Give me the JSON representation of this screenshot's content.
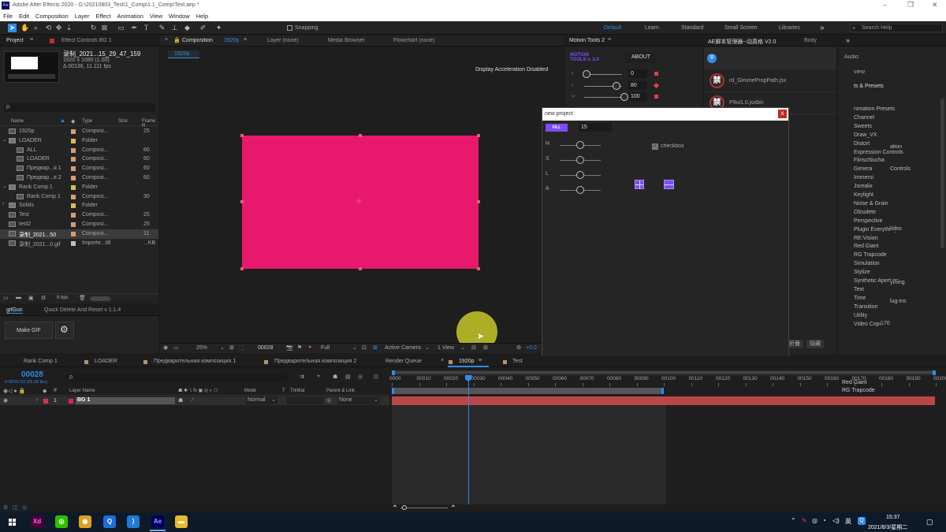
{
  "window": {
    "title": "Adobe After Effects 2020 - G:\\20210803_Test\\1_Comp\\1.1_Comp\\Text.aep *",
    "controls": {
      "minimize": "–",
      "maximize": "❐",
      "close": "✕"
    }
  },
  "menu": [
    "File",
    "Edit",
    "Composition",
    "Layer",
    "Effect",
    "Animation",
    "View",
    "Window",
    "Help"
  ],
  "toolbar": {
    "snapping_label": "Snapping",
    "workspaces": [
      "Default",
      "Learn",
      "Standard",
      "Small Screen",
      "Libraries"
    ],
    "more": "»",
    "search_placeholder": "Search Help"
  },
  "project": {
    "tab_label": "Project",
    "effect_controls_label": "Effect Controls BG 1",
    "footage_name": "录制_2021...15_29_47_159",
    "footage_res": "1920 x 1080 (1.00)",
    "footage_dur": "Δ 00136, 11.111 fps",
    "search_placeholder": "ρ.",
    "columns": [
      "Name",
      "Type",
      "Size",
      "Frame R"
    ],
    "rows": [
      {
        "name": "1920p",
        "type": "Composi...",
        "size": "25",
        "color": "#d0a070",
        "indent": 1,
        "expand": ""
      },
      {
        "name": "LOADER",
        "type": "Folder",
        "size": "",
        "color": "#d4c050",
        "indent": 0,
        "expand": "⌄"
      },
      {
        "name": "ALL",
        "type": "Composi...",
        "size": "60",
        "color": "#d0a070",
        "indent": 2,
        "expand": ""
      },
      {
        "name": "LOADER",
        "type": "Composi...",
        "size": "60",
        "color": "#d0a070",
        "indent": 2,
        "expand": ""
      },
      {
        "name": "Предвар...я 1",
        "type": "Composi...",
        "size": "60",
        "color": "#d0a070",
        "indent": 2,
        "expand": ""
      },
      {
        "name": "Предвар...я 2",
        "type": "Composi...",
        "size": "60",
        "color": "#d0a070",
        "indent": 2,
        "expand": ""
      },
      {
        "name": "Rank Comp 1",
        "type": "Folder",
        "size": "",
        "color": "#d4c050",
        "indent": 0,
        "expand": "⌄"
      },
      {
        "name": "Rank Comp 1",
        "type": "Composi...",
        "size": "30",
        "color": "#d0a070",
        "indent": 2,
        "expand": ""
      },
      {
        "name": "Solids",
        "type": "Folder",
        "size": "",
        "color": "#d4c050",
        "indent": 0,
        "expand": "›"
      },
      {
        "name": "Test",
        "type": "Composi...",
        "size": "25",
        "color": "#d0a070",
        "indent": 1,
        "expand": ""
      },
      {
        "name": "test2",
        "type": "Composi...",
        "size": "25",
        "color": "#d0a070",
        "indent": 1,
        "expand": ""
      },
      {
        "name": "录制_2021...50",
        "type": "Composi...",
        "size": "11",
        "color": "#d0a070",
        "indent": 1,
        "expand": ""
      },
      {
        "name": "录制_2021...0.gif",
        "type": "Importe...till",
        "size": "...KB",
        "color": "#c0c0c0",
        "indent": 1,
        "expand": ""
      }
    ],
    "bpc": "8 bpc"
  },
  "gifgun": {
    "tab": "gifGun",
    "tab2": "Quick Delete And Reset v 1.1.4",
    "make_gif": "Make GIF"
  },
  "comp_tabs": {
    "composition": "Composition",
    "comp_name": "1920p",
    "layer": "Layer (none)",
    "media_browser": "Media Browser",
    "flowchart": "Flowchart (none)",
    "breadcrumb": "1920p"
  },
  "viewer": {
    "display_accel": "Display Acceleration Disabled",
    "zoom": "25%",
    "timecode": "00028",
    "resolution": "Full",
    "camera": "Active Camera",
    "view": "1 View",
    "exposure": "+0.0",
    "comp_color": "#e8186d"
  },
  "motion_tools": {
    "tab": "Motion Tools 2",
    "logo_line1": "MOTION",
    "logo_line2": "TOOLS v. 2.0",
    "about": "ABOUT",
    "sliders": [
      {
        "icon": "‹",
        "value": "0",
        "level": 0.0
      },
      {
        "icon": "›",
        "value": "80",
        "level": 0.8
      },
      {
        "icon": "›‹",
        "value": "100",
        "level": 1.0
      }
    ]
  },
  "script_manager": {
    "tab": "AE脚本管理器--动真格 V2.0",
    "body_tab": "Body",
    "badge": "禁",
    "items": [
      "rd_GimmePropPath.jsx",
      "P9ui1.0.jsxbin"
    ],
    "cn_buttons": [
      "折叠",
      "隐藏"
    ]
  },
  "effects_panel": {
    "audio": "Audio",
    "preview": "view",
    "title": "ts & Presets",
    "items": [
      "nimation Presets",
      "Channel",
      "Sweets",
      "Draw_VX",
      "Distort",
      "Expression Controls",
      "Flinschlucha",
      "Genera",
      "Immersi",
      "Jsrealix",
      "Keylight",
      "Noise & Grain",
      "Obsolete",
      "Perspective",
      "Plugin Everything",
      "RE:Vision",
      "Red Giant",
      "RG Trapcode",
      "Simulation",
      "Stylize",
      "Synthetic Aperture",
      "Text",
      "Time",
      "Transition",
      "Utility",
      "Video Copilot"
    ],
    "bottom": [
      "Red Giant",
      "RG Trapcode"
    ],
    "overlap_fragments": [
      "ation",
      "Controls",
      "lideo",
      "ything",
      "lug-ins",
      "170"
    ]
  },
  "dialog": {
    "title": "new project",
    "close": "x",
    "fill_btn": "FILL",
    "value": "15",
    "sliders": [
      {
        "label": "H",
        "level": 0.5
      },
      {
        "label": "S",
        "level": 0.5
      },
      {
        "label": "L",
        "level": 0.5
      },
      {
        "label": "A",
        "level": 0.5
      }
    ],
    "checkbox_label": "checkbox",
    "checked": true
  },
  "timeline": {
    "tabs": [
      "Rank Comp 1",
      "LOADER",
      "Предварительная композиция 1",
      "Предварительная композиция 2",
      "Render Queue",
      "1920p",
      "Test"
    ],
    "active_tab": "1920p",
    "timecode": "00028",
    "timecode_sub": "0:00:01:03 (25.00 fps)",
    "search_placeholder": "ρ.",
    "columns": {
      "layer_name": "Layer Name",
      "mode": "Mode",
      "t": "T",
      "trkmat": "TrkMat",
      "parent": "Parent & Link"
    },
    "layer": {
      "number": "1",
      "name": "BG 1",
      "mode": "Normal",
      "parent": "None",
      "label_color": "#d83050"
    },
    "ruler": [
      "0000",
      "00010",
      "00020",
      "00030",
      "00040",
      "00050",
      "00060",
      "00070",
      "00080",
      "00090",
      "00100",
      "00110",
      "00120",
      "00130",
      "00140",
      "00150",
      "00160",
      "00170",
      "00180",
      "00190",
      "00200"
    ],
    "playhead_frame": 28,
    "work_area_end_frame": 100
  },
  "taskbar": {
    "apps": [
      {
        "name": "Xd",
        "color": "#470137",
        "fg": "#ff61f6"
      },
      {
        "name": "WeChat",
        "color": "#2dc100",
        "fg": "#fff"
      },
      {
        "name": "Chrome",
        "color": "#e0a020",
        "fg": "#fff"
      },
      {
        "name": "Search",
        "color": "#1e6ed8",
        "fg": "#fff"
      },
      {
        "name": "VS Code",
        "color": "#1f7ad4",
        "fg": "#fff"
      },
      {
        "name": "Ae",
        "color": "#00005b",
        "fg": "#9999ff"
      },
      {
        "name": "Explorer",
        "color": "#e8b830",
        "fg": "#fff"
      }
    ],
    "tray_lang": "英",
    "time": "15:37",
    "date": "2021/8/3/星期二"
  },
  "colors": {
    "accent": "#2d8ceb",
    "pink": "#e8186d",
    "purple": "#7c4dff",
    "close_red": "#c42b1c"
  }
}
